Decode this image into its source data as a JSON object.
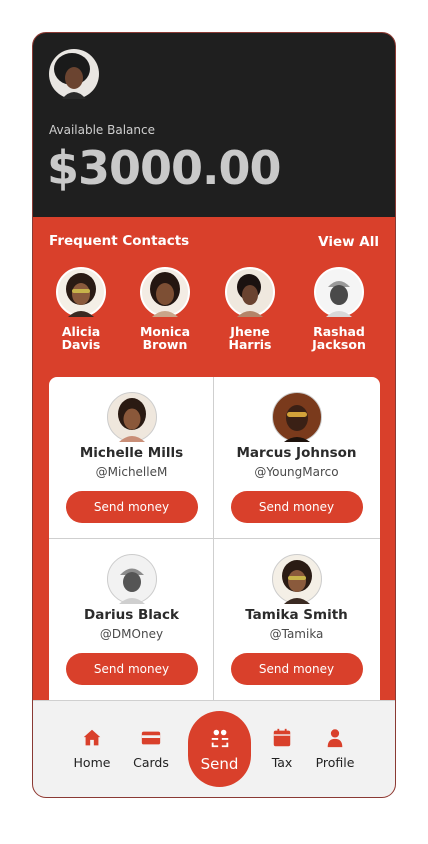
{
  "header": {
    "avatar": "user-avatar",
    "balance_label": "Available Balance",
    "balance_amount": "$3000.00"
  },
  "frequent_contacts": {
    "title": "Frequent Contacts",
    "view_all": "View All",
    "contacts": [
      {
        "name": "Alicia\nDavis",
        "avatar": "avatar-photo"
      },
      {
        "name": "Monica\nBrown",
        "avatar": "avatar-photo"
      },
      {
        "name": "Jhene\nHarris",
        "avatar": "avatar-photo"
      },
      {
        "name": "Rashad\nJackson",
        "avatar": "avatar-photo"
      }
    ]
  },
  "suggested": [
    {
      "name": "Michelle Mills",
      "handle": "@MichelleM",
      "button": "Send money"
    },
    {
      "name": "Marcus Johnson",
      "handle": "@YoungMarco",
      "button": "Send money"
    },
    {
      "name": "Darius Black",
      "handle": "@DMOney",
      "button": "Send money"
    },
    {
      "name": "Tamika Smith",
      "handle": "@Tamika",
      "button": "Send money"
    }
  ],
  "nav": {
    "items": [
      {
        "label": "Home",
        "icon": "home-icon"
      },
      {
        "label": "Cards",
        "icon": "card-icon"
      },
      {
        "label": "Send",
        "icon": "send-people-icon"
      },
      {
        "label": "Tax",
        "icon": "calendar-icon"
      },
      {
        "label": "Profile",
        "icon": "profile-icon"
      }
    ]
  },
  "colors": {
    "accent": "#d9402b",
    "header_bg": "#1f1f1f",
    "nav_bg": "#f2f2f2"
  }
}
